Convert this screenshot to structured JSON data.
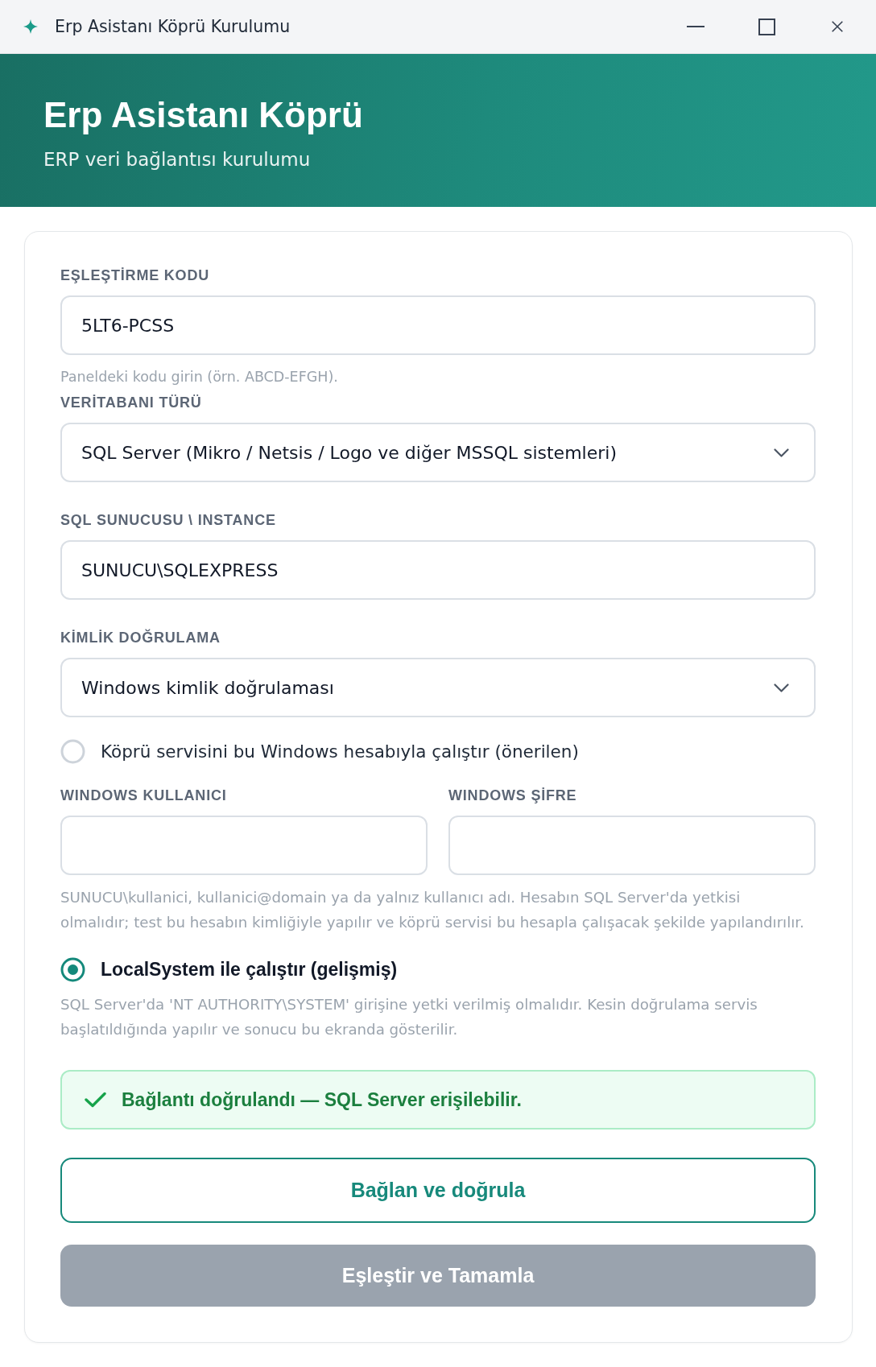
{
  "window": {
    "title": "Erp Asistanı Köprü Kurulumu"
  },
  "header": {
    "title": "Erp Asistanı Köprü",
    "subtitle": "ERP veri bağlantısı kurulumu"
  },
  "form": {
    "fields": [
      {
        "kind": "text",
        "label": "EŞLEŞTİRME KODU",
        "value": "5LT6-PCSS",
        "hint": "Paneldeki kodu girin (örn. ABCD-EFGH)."
      },
      {
        "kind": "select",
        "label": "VERİTABANI TÜRÜ",
        "value": "SQL Server (Mikro / Netsis / Logo ve diğer MSSQL sistemleri)"
      },
      {
        "kind": "text",
        "label": "SQL SUNUCUSU \\ INSTANCE",
        "value": "SUNUCU\\SQLEXPRESS"
      },
      {
        "kind": "select",
        "label": "KİMLİK DOĞRULAMA",
        "value": "Windows kimlik doğrulaması"
      }
    ],
    "run_as": [
      {
        "label": "Köprü servisini bu Windows hesabıyla çalıştır (önerilen)",
        "selected": false,
        "credentials": [
          {
            "label": "WINDOWS KULLANICI"
          },
          {
            "label": "WINDOWS ŞİFRE"
          }
        ],
        "note": "SUNUCU\\kullanici, kullanici@domain ya da yalnız kullanıcı adı. Hesabın SQL Server'da yetkisi olmalıdır; test bu hesabın kimliğiyle yapılır ve köprü servisi bu hesapla çalışacak şekilde yapılandırılır."
      },
      {
        "label": "LocalSystem ile çalıştır (gelişmiş)",
        "selected": true,
        "note": "SQL Server'da 'NT AUTHORITY\\SYSTEM' girişine yetki verilmiş olmalıdır. Kesin doğrulama servis başlatıldığında yapılır ve sonucu bu ekranda gösterilir."
      }
    ],
    "status": {
      "kind": "success",
      "text": "Bağlantı doğrulandı — SQL Server erişilebilir."
    },
    "buttons": [
      {
        "kind": "outline",
        "label": "Bağlan ve doğrula",
        "disabled": false
      },
      {
        "kind": "primary",
        "label": "Eşleştir ve Tamamla",
        "disabled": true
      }
    ]
  }
}
